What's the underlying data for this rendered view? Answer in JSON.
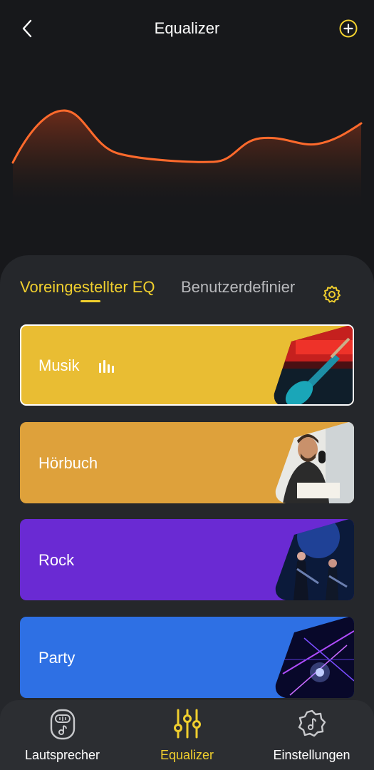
{
  "header": {
    "title": "Equalizer",
    "back_icon": "chevron-left-icon",
    "add_icon": "plus-circle-icon"
  },
  "equalizer_curve": {
    "line_color": "#ff6a2c"
  },
  "tabs": [
    {
      "label": "Voreingestellter EQ",
      "active": true
    },
    {
      "label": "Benutzerdefinier",
      "active": false
    }
  ],
  "settings_icon": "gear-icon",
  "presets": [
    {
      "label": "Musik",
      "color": "#e9bd33",
      "selected": true,
      "image": "guitar-photo"
    },
    {
      "label": "Hörbuch",
      "color": "#dea13b",
      "selected": false,
      "image": "man-at-microphone-photo"
    },
    {
      "label": "Rock",
      "color": "#6a2ad3",
      "selected": false,
      "image": "rock-concert-photo"
    },
    {
      "label": "Party",
      "color": "#2e70e4",
      "selected": false,
      "image": "party-lights-photo"
    }
  ],
  "bottom_nav": [
    {
      "label": "Lautsprecher",
      "icon": "speaker-icon",
      "active": false
    },
    {
      "label": "Equalizer",
      "icon": "sliders-icon",
      "active": true
    },
    {
      "label": "Einstellungen",
      "icon": "settings-icon",
      "active": false
    }
  ],
  "colors": {
    "accent": "#f0cf2e",
    "background": "#17181b",
    "panel": "#25272b"
  }
}
